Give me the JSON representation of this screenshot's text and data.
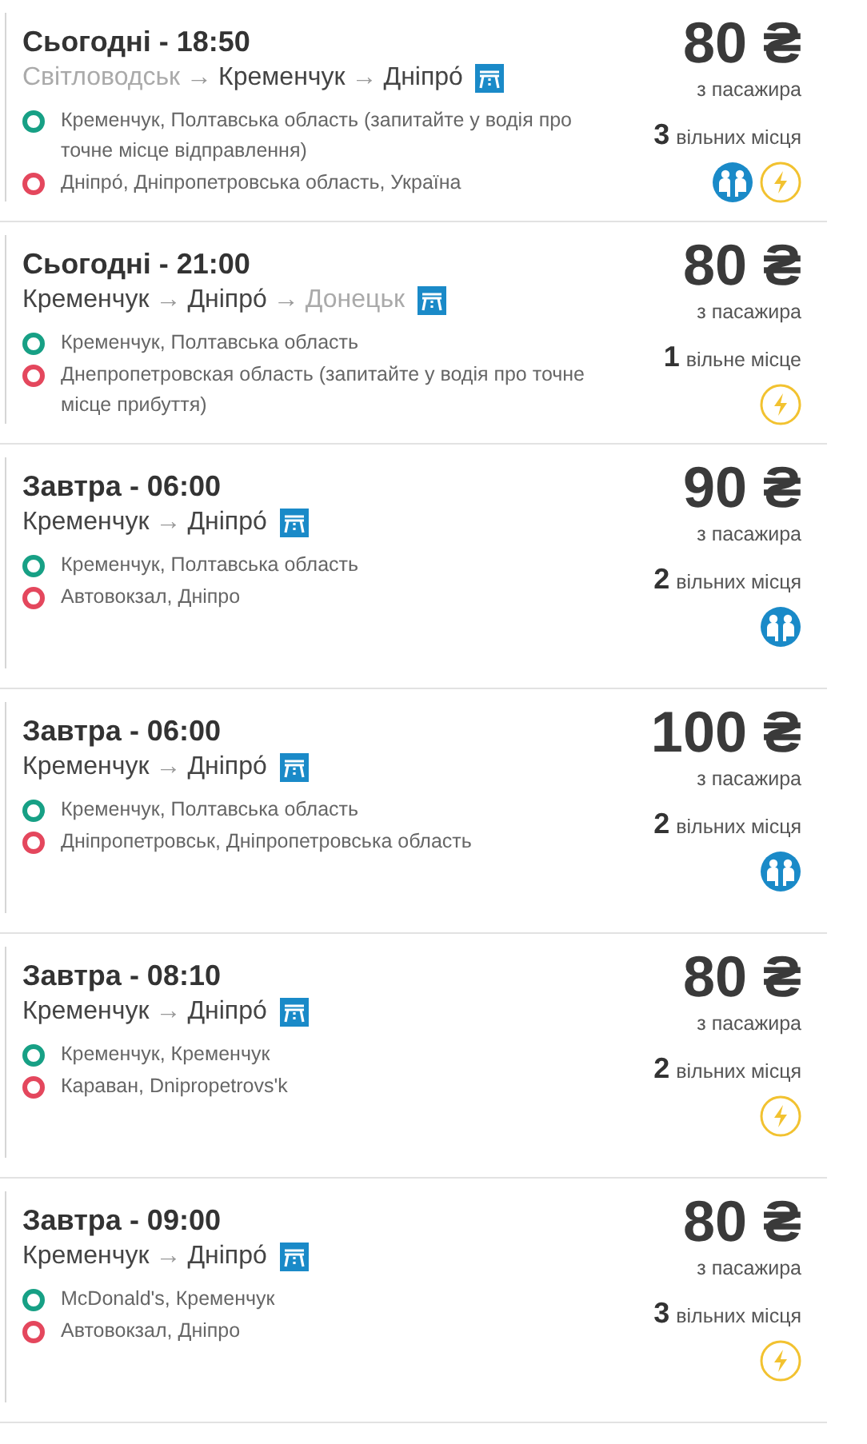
{
  "trips": [
    {
      "title": "Сьогодні - 18:50",
      "route": [
        {
          "city": "Світловодськ",
          "muted": true
        },
        {
          "city": "Кременчук",
          "muted": false
        },
        {
          "city": "Дніпро́",
          "muted": false
        }
      ],
      "arrow": "→",
      "stops": [
        {
          "kind": "departure",
          "text": "Кременчук, Полтавська область (запитайте у водія про точне місце відправлення)"
        },
        {
          "kind": "arrival",
          "text": "Дніпро́, Дніпропетровська область, Україна"
        }
      ],
      "price": "80 ₴",
      "price_note": "з пасажира",
      "seats_count": "3",
      "seats_label": "вільних місця",
      "amenities": [
        {
          "kind": "passengers"
        },
        {
          "kind": "charger"
        }
      ]
    },
    {
      "title": "Сьогодні - 21:00",
      "route": [
        {
          "city": "Кременчук",
          "muted": false
        },
        {
          "city": "Дніпро́",
          "muted": false
        },
        {
          "city": "Донецьк",
          "muted": true
        }
      ],
      "arrow": "→",
      "stops": [
        {
          "kind": "departure",
          "text": "Кременчук, Полтавська область"
        },
        {
          "kind": "arrival",
          "text": "Днепропетровская область (запитайте у водія про точне місце прибуття)"
        }
      ],
      "price": "80 ₴",
      "price_note": "з пасажира",
      "seats_count": "1",
      "seats_label": "вільне місце",
      "amenities": [
        {
          "kind": "charger"
        }
      ]
    },
    {
      "title": "Завтра - 06:00",
      "route": [
        {
          "city": "Кременчук",
          "muted": false
        },
        {
          "city": "Дніпро́",
          "muted": false
        }
      ],
      "arrow": "→",
      "stops": [
        {
          "kind": "departure",
          "text": "Кременчук, Полтавська область"
        },
        {
          "kind": "arrival",
          "text": "Автовокзал, Дніпро"
        }
      ],
      "price": "90 ₴",
      "price_note": "з пасажира",
      "seats_count": "2",
      "seats_label": "вільних місця",
      "amenities": [
        {
          "kind": "passengers"
        }
      ]
    },
    {
      "title": "Завтра - 06:00",
      "route": [
        {
          "city": "Кременчук",
          "muted": false
        },
        {
          "city": "Дніпро́",
          "muted": false
        }
      ],
      "arrow": "→",
      "stops": [
        {
          "kind": "departure",
          "text": "Кременчук, Полтавська область"
        },
        {
          "kind": "arrival",
          "text": "Дніпропетровськ, Дніпропетровська область"
        }
      ],
      "price": "100 ₴",
      "price_note": "з пасажира",
      "seats_count": "2",
      "seats_label": "вільних місця",
      "amenities": [
        {
          "kind": "passengers"
        }
      ]
    },
    {
      "title": "Завтра - 08:10",
      "route": [
        {
          "city": "Кременчук",
          "muted": false
        },
        {
          "city": "Дніпро́",
          "muted": false
        }
      ],
      "arrow": "→",
      "stops": [
        {
          "kind": "departure",
          "text": "Кременчук, Кременчук"
        },
        {
          "kind": "arrival",
          "text": "Караван, Dnipropetrovs'k"
        }
      ],
      "price": "80 ₴",
      "price_note": "з пасажира",
      "seats_count": "2",
      "seats_label": "вільних місця",
      "amenities": [
        {
          "kind": "charger"
        }
      ]
    },
    {
      "title": "Завтра - 09:00",
      "route": [
        {
          "city": "Кременчук",
          "muted": false
        },
        {
          "city": "Дніпро́",
          "muted": false
        }
      ],
      "arrow": "→",
      "stops": [
        {
          "kind": "departure",
          "text": "McDonald's, Кременчук"
        },
        {
          "kind": "arrival",
          "text": "Автовокзал, Дніпро"
        }
      ],
      "price": "80 ₴",
      "price_note": "з пасажира",
      "seats_count": "3",
      "seats_label": "вільних місця",
      "amenities": [
        {
          "kind": "charger"
        }
      ]
    }
  ]
}
